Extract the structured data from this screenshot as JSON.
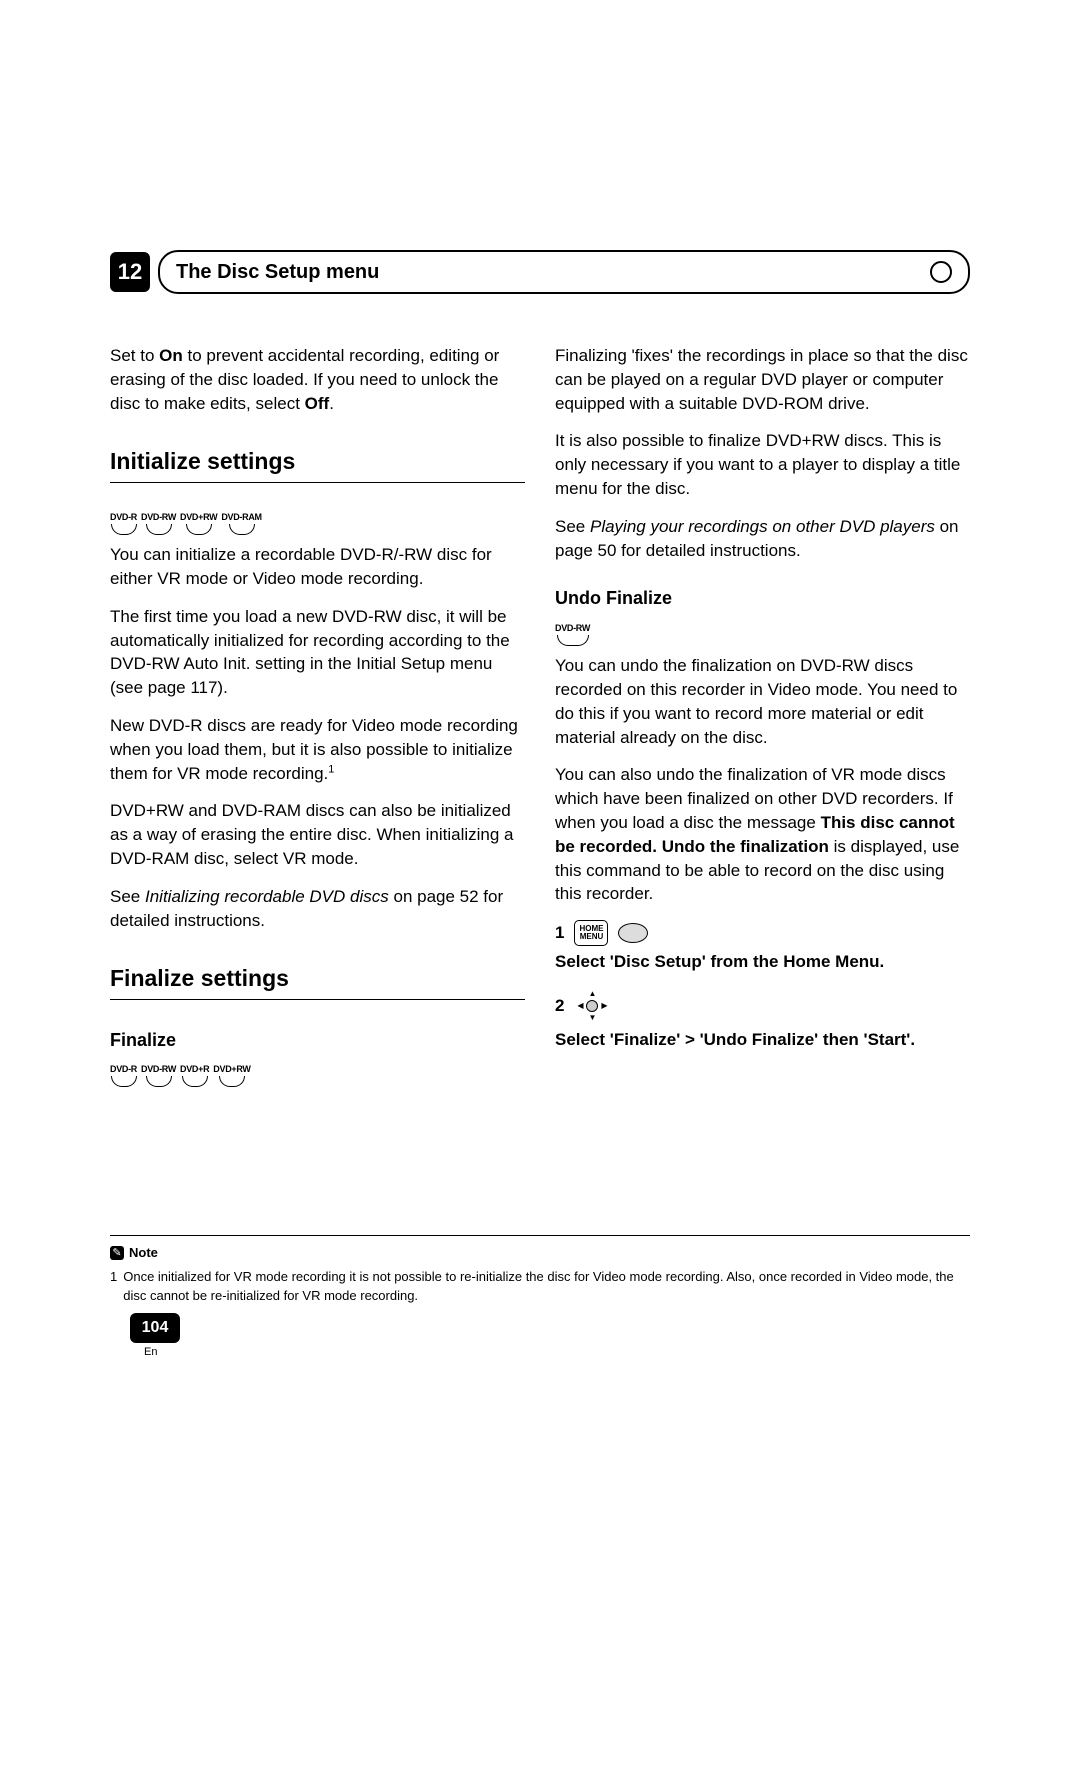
{
  "header": {
    "number": "12",
    "title": "The Disc Setup menu"
  },
  "left": {
    "intro": {
      "pre": "Set to ",
      "on": "On",
      "mid": " to prevent accidental recording, editing or erasing of the disc loaded. If you need to unlock the disc to make edits, select ",
      "off": "Off",
      "end": "."
    },
    "init": {
      "heading": "Initialize settings",
      "discs": [
        "DVD-R",
        "DVD-RW",
        "DVD+RW",
        "DVD-RAM"
      ],
      "p1": "You can initialize a recordable DVD-R/-RW disc for either VR mode or Video mode recording.",
      "p2": "The first time you load a new DVD-RW disc, it will be automatically initialized for recording according to the DVD-RW Auto Init. setting in the Initial Setup menu (see page 117).",
      "p3": "New DVD-R discs are ready for Video mode recording when you load them, but it is also possible to initialize them for VR mode recording.",
      "sup": "1",
      "p4": "DVD+RW and DVD-RAM discs can also be initialized as a way of erasing the entire disc. When initializing a DVD-RAM disc, select VR mode.",
      "see1": "See ",
      "see_em": "Initializing recordable DVD discs",
      "see2": " on page 52 for detailed instructions."
    },
    "finalize": {
      "heading": "Finalize settings",
      "sub": "Finalize",
      "discs": [
        "DVD-R",
        "DVD-RW",
        "DVD+R",
        "DVD+RW"
      ]
    }
  },
  "right": {
    "p1": "Finalizing 'fixes' the recordings in place so that the disc can be played on a regular DVD player or computer equipped with a suitable DVD-ROM drive.",
    "p2": "It is also possible to finalize DVD+RW discs. This is only necessary if you want to a player to display a title menu for the disc.",
    "see1": "See ",
    "see_em": "Playing your recordings on other DVD players",
    "see2": " on page 50 for detailed instructions.",
    "undo": {
      "heading": "Undo Finalize",
      "discs": [
        "DVD-RW"
      ],
      "p1": "You can undo the finalization on DVD-RW discs recorded on this recorder in Video mode. You need to do this if you want to record more material or edit material already on the disc.",
      "p2a": "You can also undo the finalization of VR mode discs which have been finalized on other DVD recorders. If when you load a disc the message ",
      "p2b": "This disc cannot be recorded. Undo the finalization",
      "p2c": " is displayed, use this command to be able to record on the disc using this recorder.",
      "step1_num": "1",
      "step1_icon": "HOME MENU",
      "step1_text": "Select 'Disc Setup' from the Home Menu.",
      "step2_num": "2",
      "step2_text": "Select 'Finalize' > 'Undo Finalize' then 'Start'."
    }
  },
  "footer": {
    "note_label": "Note",
    "fn_num": "1",
    "fn_text": "Once initialized for VR mode recording it is not possible to re-initialize the disc for Video mode recording. Also, once recorded in Video mode, the disc cannot be re-initialized for VR mode recording.",
    "page_num": "104",
    "lang": "En"
  }
}
